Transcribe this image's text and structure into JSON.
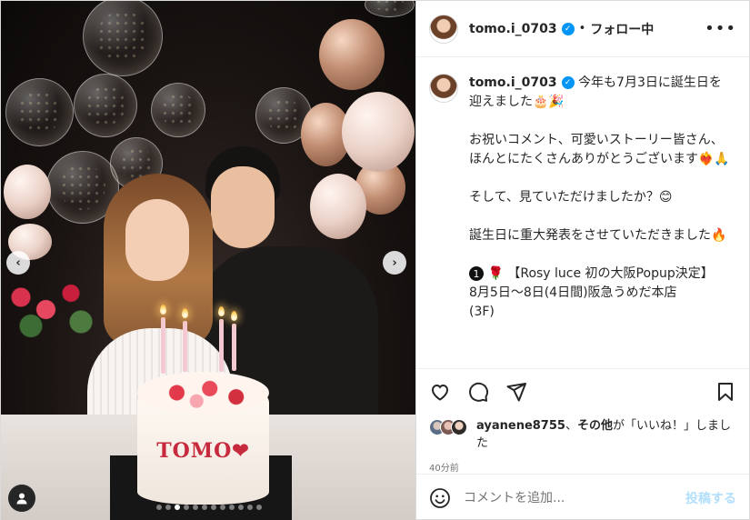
{
  "post": {
    "username": "tomo.i_0703",
    "follow_label": "フォロー中",
    "sep": "•",
    "more_label": "•••"
  },
  "caption": {
    "username": "tomo.i_0703",
    "paragraphs": [
      "今年も7月3日に誕生日を迎えました🎂🎉",
      "お祝いコメント、可愛いストーリー皆さん、ほんとにたくさんありがとうございます❤️‍🔥🙏",
      "そして、見ていただけましたか？😊",
      "誕生日に重大発表をさせていただきました🔥"
    ],
    "item_number": "1",
    "item_emoji": "🌹",
    "item_title": "【Rosy luce 初の大阪Popup決定】",
    "item_line2": "8月5日〜8日(4日間)阪急うめだ本店",
    "item_line3": "(3F)"
  },
  "likes": {
    "user": "ayanene8755",
    "middle": "、",
    "others": "その他",
    "suffix": "が「いいね！」しました"
  },
  "timestamp": "40分前",
  "comment": {
    "placeholder": "コメントを追加...",
    "post_label": "投稿する"
  },
  "photo": {
    "cake_text": "TOMO❤",
    "carousel_dots": 12,
    "active_dot": 2,
    "prev_arrow": "‹",
    "next_arrow": "›"
  },
  "colors": {
    "accent": "#0095f6",
    "post_button_disabled": "#b2dffc",
    "heart_red": "#c72a3d"
  }
}
